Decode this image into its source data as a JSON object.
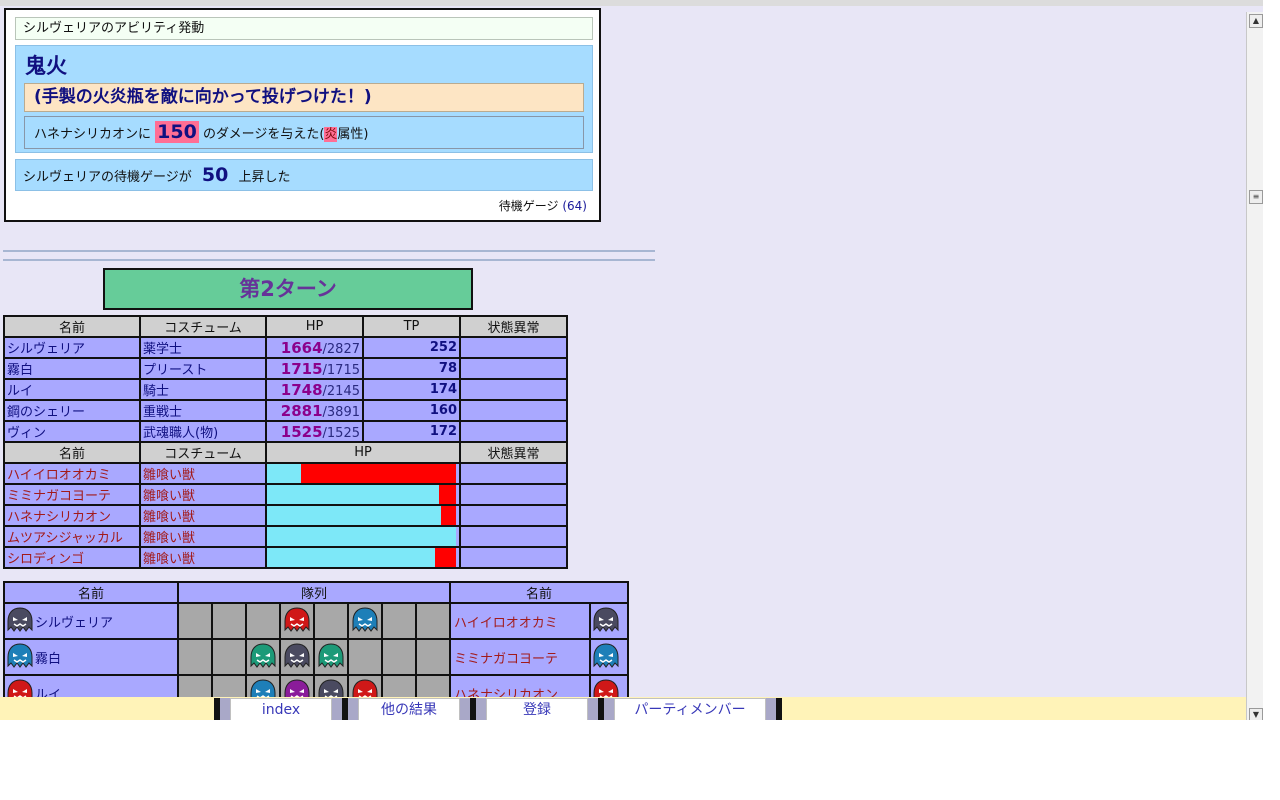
{
  "ability": {
    "header": "シルヴェリアのアビリティ発動",
    "skill_name": "鬼火",
    "quote": "(手製の火炎瓶を敵に向かって投げつけた！)",
    "damage_target": "ハネナシリカオンに",
    "damage_value": "150",
    "damage_suffix": "のダメージを与えた(",
    "element": "炎",
    "element_suffix": "属性)",
    "gauge_prefix": "シルヴェリアの待機ゲージが",
    "gauge_value": "50",
    "gauge_suffix": "上昇した",
    "gauge_label": "待機ゲージ",
    "gauge_total": "(64)"
  },
  "turn": {
    "title": "第2ターン"
  },
  "party_table": {
    "headers": [
      "名前",
      "コスチューム",
      "HP",
      "TP",
      "状態異常"
    ],
    "rows": [
      {
        "name": "シルヴェリア",
        "costume": "薬学士",
        "hp": "1664",
        "hp_max": "/2827",
        "tp": "252",
        "status": ""
      },
      {
        "name": "霧白",
        "costume": "プリースト",
        "hp": "1715",
        "hp_max": "/1715",
        "tp": "78",
        "status": ""
      },
      {
        "name": "ルイ",
        "costume": "騎士",
        "hp": "1748",
        "hp_max": "/2145",
        "tp": "174",
        "status": ""
      },
      {
        "name": "鋼のシェリー",
        "costume": "重戦士",
        "hp": "2881",
        "hp_max": "/3891",
        "tp": "160",
        "status": ""
      },
      {
        "name": "ヴィン",
        "costume": "武魂職人(物)",
        "hp": "1525",
        "hp_max": "/1525",
        "tp": "172",
        "status": ""
      }
    ]
  },
  "enemy_table": {
    "headers": [
      "名前",
      "コスチューム",
      "HP",
      "状態異常"
    ],
    "rows": [
      {
        "name": "ハイイロオオカミ",
        "costume": "雛喰い獣",
        "hp_ratio": 0.18
      },
      {
        "name": "ミミナガコヨーテ",
        "costume": "雛喰い獣",
        "hp_ratio": 0.91
      },
      {
        "name": "ハネナシリカオン",
        "costume": "雛喰い獣",
        "hp_ratio": 0.92
      },
      {
        "name": "ムツアシジャッカル",
        "costume": "雛喰い獣",
        "hp_ratio": 1.0
      },
      {
        "name": "シロディンゴ",
        "costume": "雛喰い獣",
        "hp_ratio": 0.89
      }
    ]
  },
  "formation": {
    "headers": [
      "名前",
      "隊列",
      "名前"
    ],
    "rows": [
      {
        "ally": "シルヴェリア",
        "ally_icon": "#4a4a60",
        "enemy": "ハイイロオオカミ",
        "enemy_icon": "#4a4a60"
      },
      {
        "ally": "霧白",
        "ally_icon": "#1e7fb8",
        "enemy": "ミミナガコヨーテ",
        "enemy_icon": "#1e7fb8"
      },
      {
        "ally": "ルイ",
        "ally_icon": "#d01818",
        "enemy": "ハネナシリカオン",
        "enemy_icon": "#d01818"
      }
    ]
  },
  "nav": {
    "index": "index",
    "other": "他の結果",
    "register": "登録",
    "party": "パーティメンバー"
  },
  "colors": {
    "red_ghost": "#d01818",
    "blue_ghost": "#1e7fb8",
    "teal_ghost": "#1c9a78",
    "dark_ghost": "#4a4a60",
    "purple_ghost": "#8a1c9a"
  }
}
